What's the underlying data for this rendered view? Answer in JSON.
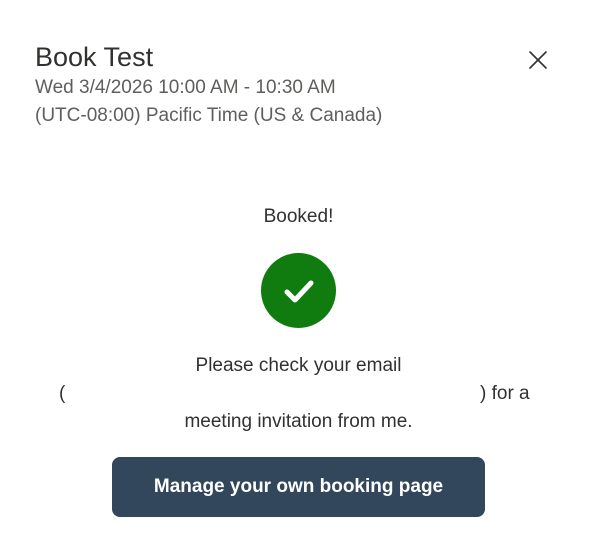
{
  "dialog": {
    "title": "Book Test",
    "datetime": "Wed 3/4/2026 10:00 AM - 10:30 AM",
    "timezone": "(UTC-08:00) Pacific Time (US & Canada)",
    "close_icon": "close-icon"
  },
  "confirmation": {
    "status": "Booked!",
    "status_icon": "checkmark-icon",
    "status_color": "#107c10",
    "message_line1": "Please check your email",
    "paren_open": "(",
    "email": "",
    "paren_close": ") for a",
    "message_line3": "meeting invitation from me."
  },
  "actions": {
    "manage_label": "Manage your own booking page",
    "manage_color": "#32475c"
  }
}
